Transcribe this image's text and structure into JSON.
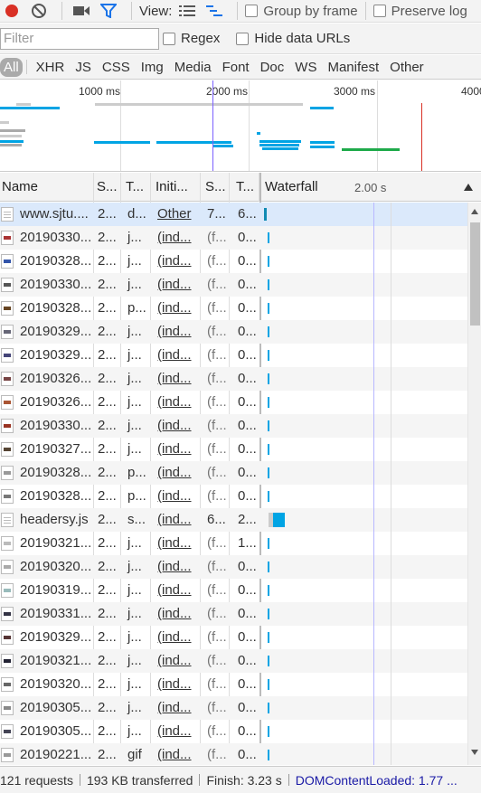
{
  "toolbar": {
    "view_label": "View:",
    "group_by_frame": "Group by frame",
    "preserve_log": "Preserve log"
  },
  "filter": {
    "placeholder": "Filter",
    "regex": "Regex",
    "hide_data_urls": "Hide data URLs"
  },
  "types": [
    "All",
    "XHR",
    "JS",
    "CSS",
    "Img",
    "Media",
    "Font",
    "Doc",
    "WS",
    "Manifest",
    "Other"
  ],
  "overview": {
    "ticks": [
      "1000 ms",
      "2000 ms",
      "3000 ms",
      "4000"
    ]
  },
  "columns": {
    "name": "Name",
    "status": "S...",
    "type": "T...",
    "initiator": "Initi...",
    "size": "S...",
    "time": "T...",
    "waterfall": "Waterfall",
    "waterfall_time": "2.00 s"
  },
  "rows": [
    {
      "name": "www.sjtu....",
      "status": "2...",
      "type": "d...",
      "initiator": "Other",
      "size": "7...",
      "time": "6...",
      "icon": "doc",
      "thumb": "#eee"
    },
    {
      "name": "20190330...",
      "status": "2...",
      "type": "j...",
      "initiator": "(ind...",
      "size": "(f...",
      "time": "0...",
      "icon": "img",
      "thumb": "#a33"
    },
    {
      "name": "20190328...",
      "status": "2...",
      "type": "j...",
      "initiator": "(ind...",
      "size": "(f...",
      "time": "0...",
      "icon": "img",
      "thumb": "#35a"
    },
    {
      "name": "20190330...",
      "status": "2...",
      "type": "j...",
      "initiator": "(ind...",
      "size": "(f...",
      "time": "0...",
      "icon": "img",
      "thumb": "#555"
    },
    {
      "name": "20190328...",
      "status": "2...",
      "type": "p...",
      "initiator": "(ind...",
      "size": "(f...",
      "time": "0...",
      "icon": "img",
      "thumb": "#642"
    },
    {
      "name": "20190329...",
      "status": "2...",
      "type": "j...",
      "initiator": "(ind...",
      "size": "(f...",
      "time": "0...",
      "icon": "img",
      "thumb": "#667"
    },
    {
      "name": "20190329...",
      "status": "2...",
      "type": "j...",
      "initiator": "(ind...",
      "size": "(f...",
      "time": "0...",
      "icon": "img",
      "thumb": "#447"
    },
    {
      "name": "20190326...",
      "status": "2...",
      "type": "j...",
      "initiator": "(ind...",
      "size": "(f...",
      "time": "0...",
      "icon": "img",
      "thumb": "#744"
    },
    {
      "name": "20190326...",
      "status": "2...",
      "type": "j...",
      "initiator": "(ind...",
      "size": "(f...",
      "time": "0...",
      "icon": "img",
      "thumb": "#a53"
    },
    {
      "name": "20190330...",
      "status": "2...",
      "type": "j...",
      "initiator": "(ind...",
      "size": "(f...",
      "time": "0...",
      "icon": "img",
      "thumb": "#932"
    },
    {
      "name": "20190327...",
      "status": "2...",
      "type": "j...",
      "initiator": "(ind...",
      "size": "(f...",
      "time": "0...",
      "icon": "img",
      "thumb": "#543"
    },
    {
      "name": "20190328...",
      "status": "2...",
      "type": "p...",
      "initiator": "(ind...",
      "size": "(f...",
      "time": "0...",
      "icon": "img",
      "thumb": "#999"
    },
    {
      "name": "20190328...",
      "status": "2...",
      "type": "p...",
      "initiator": "(ind...",
      "size": "(f...",
      "time": "0...",
      "icon": "img",
      "thumb": "#777"
    },
    {
      "name": "headersy.js",
      "status": "2...",
      "type": "s...",
      "initiator": "(ind...",
      "size": "6...",
      "time": "2...",
      "icon": "doc",
      "thumb": "#eee"
    },
    {
      "name": "20190321...",
      "status": "2...",
      "type": "j...",
      "initiator": "(ind...",
      "size": "(f...",
      "time": "1...",
      "icon": "img",
      "thumb": "#bbb"
    },
    {
      "name": "20190320...",
      "status": "2...",
      "type": "j...",
      "initiator": "(ind...",
      "size": "(f...",
      "time": "0...",
      "icon": "img",
      "thumb": "#aaa"
    },
    {
      "name": "20190319...",
      "status": "2...",
      "type": "j...",
      "initiator": "(ind...",
      "size": "(f...",
      "time": "0...",
      "icon": "img",
      "thumb": "#9bb"
    },
    {
      "name": "20190331...",
      "status": "2...",
      "type": "j...",
      "initiator": "(ind...",
      "size": "(f...",
      "time": "0...",
      "icon": "img",
      "thumb": "#334"
    },
    {
      "name": "20190329...",
      "status": "2...",
      "type": "j...",
      "initiator": "(ind...",
      "size": "(f...",
      "time": "0...",
      "icon": "img",
      "thumb": "#533"
    },
    {
      "name": "20190321...",
      "status": "2...",
      "type": "j...",
      "initiator": "(ind...",
      "size": "(f...",
      "time": "0...",
      "icon": "img",
      "thumb": "#223"
    },
    {
      "name": "20190320...",
      "status": "2...",
      "type": "j...",
      "initiator": "(ind...",
      "size": "(f...",
      "time": "0...",
      "icon": "img",
      "thumb": "#666"
    },
    {
      "name": "20190305...",
      "status": "2...",
      "type": "j...",
      "initiator": "(ind...",
      "size": "(f...",
      "time": "0...",
      "icon": "img",
      "thumb": "#888"
    },
    {
      "name": "20190305...",
      "status": "2...",
      "type": "j...",
      "initiator": "(ind...",
      "size": "(f...",
      "time": "0...",
      "icon": "img",
      "thumb": "#445"
    },
    {
      "name": "20190221...",
      "status": "2...",
      "type": "gif",
      "initiator": "(ind...",
      "size": "(f...",
      "time": "0...",
      "icon": "img",
      "thumb": "#999"
    }
  ],
  "status": {
    "requests": "121 requests",
    "transferred": "193 KB transferred",
    "finish": "Finish: 3.23 s",
    "dom_content_loaded": "DOMContentLoaded: 1.77 ..."
  },
  "colors": {
    "record": "#d93025",
    "filter_active": "#1a73e8",
    "waterfall_bar": "#00a4e4",
    "dom_line": "#7b61ff",
    "load_line": "#d93025"
  }
}
